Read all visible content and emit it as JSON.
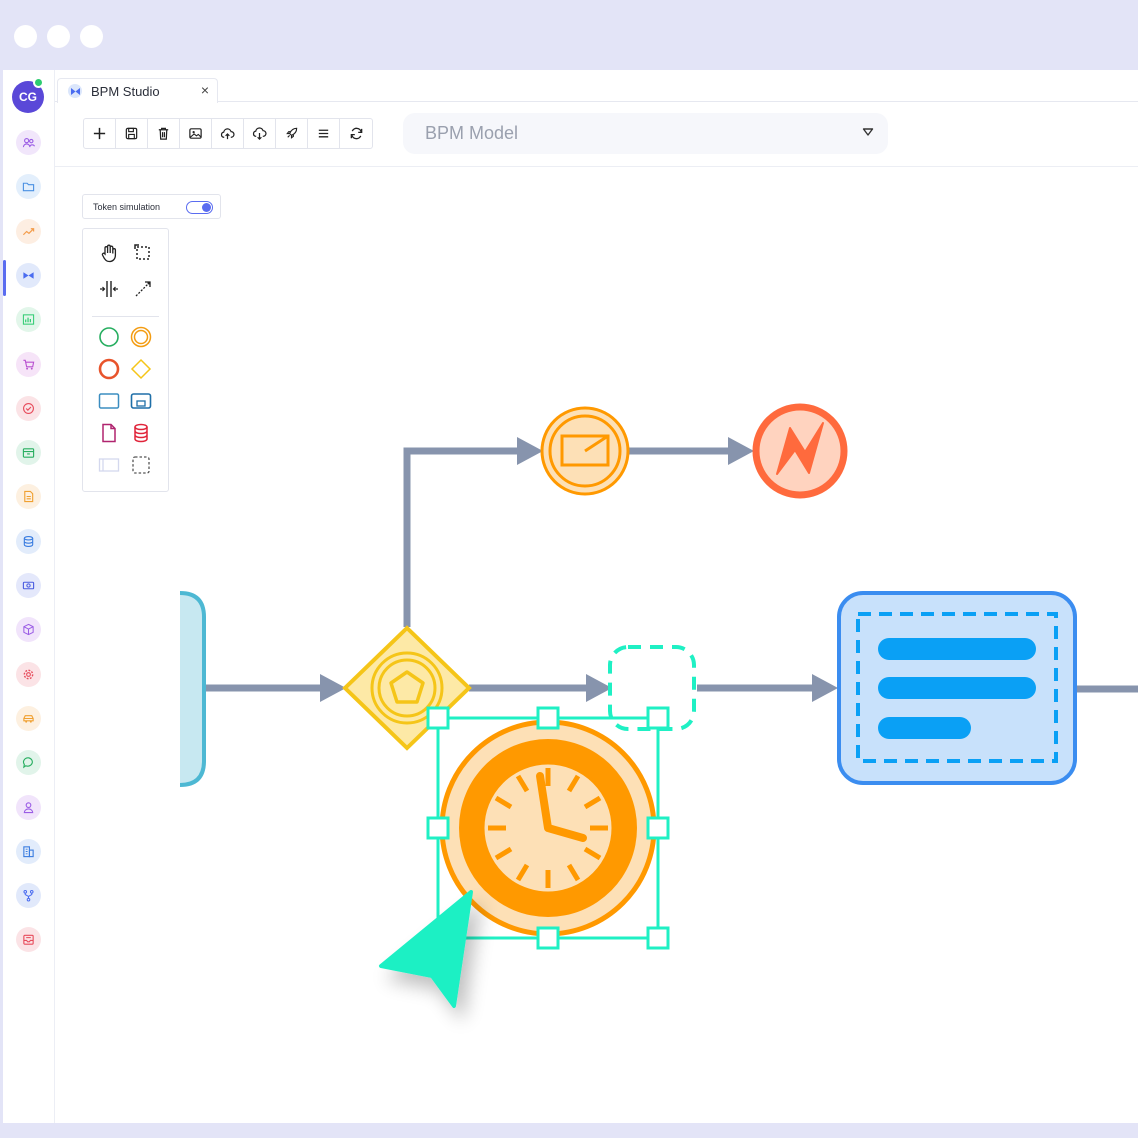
{
  "window": {
    "dots": [
      "window-dot-1",
      "window-dot-2",
      "window-dot-3"
    ]
  },
  "user": {
    "initials": "CG",
    "status_color": "#2ecc71"
  },
  "sidebar": {
    "items": [
      {
        "name": "users-icon",
        "bg": "#f1e6fb",
        "color": "#9b5de5"
      },
      {
        "name": "folder-icon",
        "bg": "#e3effc",
        "color": "#4a90e2"
      },
      {
        "name": "trend-icon",
        "bg": "#fdeee2",
        "color": "#f39c4a"
      },
      {
        "name": "bpm-icon",
        "bg": "#e1e9fb",
        "color": "#4a6cf0"
      },
      {
        "name": "chart-icon",
        "bg": "#e2f6ea",
        "color": "#2ecc71"
      },
      {
        "name": "cart-icon",
        "bg": "#f6e4f8",
        "color": "#b84fd0"
      },
      {
        "name": "check-icon",
        "bg": "#fbe3e6",
        "color": "#e74c5c"
      },
      {
        "name": "box-icon",
        "bg": "#e1f4ea",
        "color": "#27ae60"
      },
      {
        "name": "document-icon",
        "bg": "#fdf0e0",
        "color": "#f0a030"
      },
      {
        "name": "database-icon",
        "bg": "#e2ecfb",
        "color": "#3b7de0"
      },
      {
        "name": "money-icon",
        "bg": "#e4e8fb",
        "color": "#4a5ce0"
      },
      {
        "name": "cube-icon",
        "bg": "#f1e4fb",
        "color": "#9b5de5"
      },
      {
        "name": "gear-icon",
        "bg": "#fbe3e6",
        "color": "#e74c5c"
      },
      {
        "name": "car-icon",
        "bg": "#fdf0e0",
        "color": "#f0a030"
      },
      {
        "name": "chat-icon",
        "bg": "#e1f4ea",
        "color": "#27ae60"
      },
      {
        "name": "person-icon",
        "bg": "#f1e4fb",
        "color": "#9b5de5"
      },
      {
        "name": "building-icon",
        "bg": "#e2ecfb",
        "color": "#3b7de0"
      },
      {
        "name": "fork-icon",
        "bg": "#e1e9fb",
        "color": "#4a6cf0"
      },
      {
        "name": "inbox-icon",
        "bg": "#fbe3e6",
        "color": "#e74c5c"
      }
    ]
  },
  "tab": {
    "label": "BPM Studio",
    "close": "×"
  },
  "toolbar": {
    "buttons": [
      "add-button",
      "save-button",
      "delete-button",
      "image-button",
      "upload-button",
      "download-button",
      "deploy-button",
      "menu-button",
      "refresh-button"
    ]
  },
  "model_select": {
    "value": "BPM Model"
  },
  "token_simulation": {
    "label": "Token simulation",
    "enabled": true
  },
  "palette": {
    "tools": [
      "hand-tool",
      "lasso-tool",
      "space-tool",
      "connect-tool"
    ],
    "shapes": [
      "start-event",
      "intermediate-event",
      "end-event",
      "gateway",
      "task",
      "subprocess",
      "data-object",
      "data-store",
      "pool",
      "group"
    ]
  },
  "colors": {
    "flow": "#8794ad",
    "timer": "#ff9900",
    "timer_fill": "#fde0b6",
    "end_event": "#ff6a3d",
    "gateway": "#f5c518",
    "task_border": "#3b8df0",
    "task_fill": "#c8e1fb",
    "selection": "#1ff0c4",
    "start_border": "#4db8d3"
  }
}
